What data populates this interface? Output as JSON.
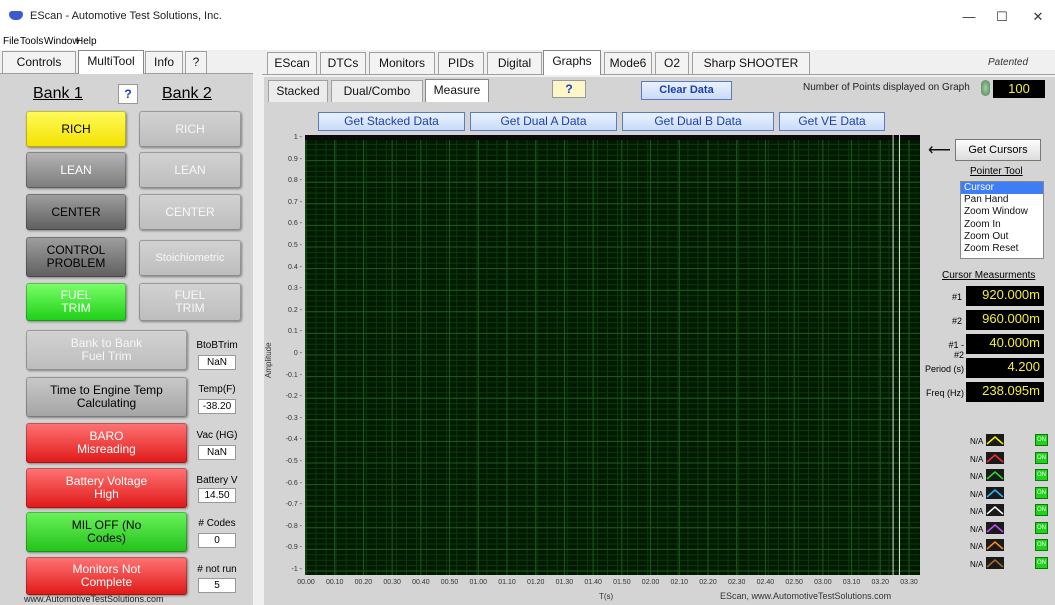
{
  "window": {
    "title": "EScan - Automotive Test Solutions, Inc.",
    "controls": [
      "—",
      "☐",
      "✕"
    ]
  },
  "menu": [
    "File",
    "Tools",
    "Window",
    "Help"
  ],
  "left_tabs": [
    {
      "label": "Controls",
      "active": false
    },
    {
      "label": "MultiTool",
      "active": true
    },
    {
      "label": "Info",
      "active": false
    },
    {
      "label": "?",
      "active": false
    }
  ],
  "main_tabs": [
    {
      "label": "EScan",
      "active": false
    },
    {
      "label": "DTCs",
      "active": false
    },
    {
      "label": "Monitors",
      "active": false
    },
    {
      "label": "PIDs",
      "active": false
    },
    {
      "label": "Digital",
      "active": false
    },
    {
      "label": "Graphs",
      "active": true
    },
    {
      "label": "Mode6",
      "active": false
    },
    {
      "label": "O2",
      "active": false
    },
    {
      "label": "Sharp SHOOTER",
      "active": false
    }
  ],
  "patented": "Patented",
  "sub_tabs": [
    {
      "label": "Stacked",
      "active": false
    },
    {
      "label": "Dual/Combo",
      "active": false
    },
    {
      "label": "Measure",
      "active": true
    }
  ],
  "help_button": "?",
  "clear_data": "Clear Data",
  "points_label": "Number of Points displayed on Graph",
  "points_value": "100",
  "bank": {
    "bank1": "Bank 1",
    "q": "?",
    "bank2": "Bank 2"
  },
  "bank1_buttons": [
    "RICH",
    "LEAN",
    "CENTER",
    "CONTROL PROBLEM",
    "FUEL TRIM"
  ],
  "bank2_buttons": [
    "RICH",
    "LEAN",
    "CENTER",
    "Stoichiometric",
    "FUEL TRIM"
  ],
  "status_rows": [
    {
      "button": "Bank to Bank Fuel Trim",
      "label": "BtoBTrim",
      "value": "NaN"
    },
    {
      "button": "Time to Engine Temp Calculating",
      "label": "Temp(F)",
      "value": "-38.20"
    },
    {
      "button": "BARO Misreading",
      "label": "Vac (HG)",
      "value": "NaN"
    },
    {
      "button": "Battery Voltage High",
      "label": "Battery V",
      "value": "14.50"
    },
    {
      "button": "MIL OFF (No Codes)",
      "label": "# Codes",
      "value": "0"
    },
    {
      "button": "Monitors Not Complete",
      "label": "# not run",
      "value": "5"
    }
  ],
  "footer_left": "www.AutomotiveTestSolutions.com",
  "data_buttons": [
    "Get Stacked Data",
    "Get Dual A Data",
    "Get Dual B Data",
    "Get VE Data"
  ],
  "get_cursors": "Get Cursors",
  "arrow": "⟵",
  "pointer_tool": {
    "title": "Pointer Tool",
    "options": [
      "Cursor",
      "Pan Hand",
      "Zoom Window",
      "Zoom In",
      "Zoom Out",
      "Zoom Reset"
    ],
    "selected": "Cursor"
  },
  "cursor_measurements": {
    "title": "Cursor Measurments",
    "rows": [
      {
        "label": "#1",
        "value": "920.000m"
      },
      {
        "label": "#2",
        "value": "960.000m"
      },
      {
        "label": "#1 - #2",
        "value": "40.000m"
      },
      {
        "label": "Period (s)",
        "value": "4.200"
      },
      {
        "label": "Freq (Hz)",
        "value": "238.095m"
      }
    ]
  },
  "legend": [
    {
      "label": "N/A",
      "color": "#f5f000",
      "on": "ON"
    },
    {
      "label": "N/A",
      "color": "#ff2a2a",
      "on": "ON"
    },
    {
      "label": "N/A",
      "color": "#22e022",
      "on": "ON"
    },
    {
      "label": "N/A",
      "color": "#2ab6ff",
      "on": "ON"
    },
    {
      "label": "N/A",
      "color": "#ffffff",
      "on": "ON"
    },
    {
      "label": "N/A",
      "color": "#c84cff",
      "on": "ON"
    },
    {
      "label": "N/A",
      "color": "#ff8a18",
      "on": "ON"
    },
    {
      "label": "N/A",
      "color": "#a86a2a",
      "on": "ON"
    }
  ],
  "graph_footer": "EScan, www.AutomotiveTestSolutions.com",
  "chart_data": {
    "type": "line",
    "xlabel": "T(s)",
    "ylabel": "Amplitude",
    "x_ticks": [
      "00.00",
      "00.10",
      "00.20",
      "00.30",
      "00.40",
      "00.50",
      "01.00",
      "01.10",
      "01.20",
      "01.30",
      "01.40",
      "01.50",
      "02.00",
      "02.10",
      "02.20",
      "02.30",
      "02.40",
      "02.50",
      "03.00",
      "03.10",
      "03.20",
      "03.30"
    ],
    "y_ticks": [
      "1",
      "0.9",
      "0.8",
      "0.7",
      "0.6",
      "0.5",
      "0.4",
      "0.3",
      "0.2",
      "0.1",
      "0",
      "-0.1",
      "-0.2",
      "-0.3",
      "-0.4",
      "-0.5",
      "-0.6",
      "-0.7",
      "-0.8",
      "-0.9",
      "-1"
    ],
    "ylim": [
      -1,
      1
    ],
    "grid": true,
    "background": "#001a00",
    "gridColor": "#1f5a1f",
    "series": [],
    "cursors": [
      0.92,
      0.96
    ]
  }
}
